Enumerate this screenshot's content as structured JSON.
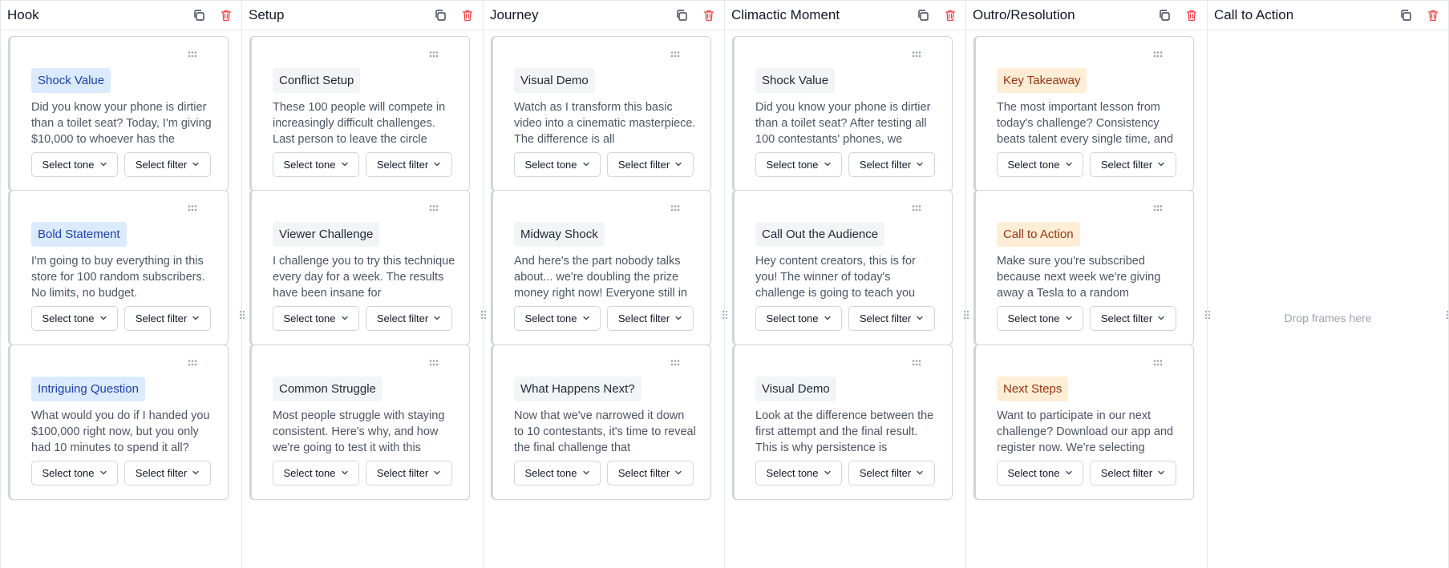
{
  "colors": {
    "border": "#e5e7eb",
    "delete": "#ef4444",
    "blue_tag_bg": "#dbeafe",
    "gray_tag_bg": "#f3f4f6",
    "orange_tag_bg": "#ffedd5"
  },
  "columns": [
    {
      "title": "Hook",
      "cards": [
        {
          "tag": "Shock Value",
          "tag_color": "blue",
          "text": "Did you know your phone is dirtier than a toilet seat? Today, I'm giving $10,000 to whoever has the",
          "tone": "Select tone",
          "filter": "Select filter"
        },
        {
          "tag": "Bold Statement",
          "tag_color": "blue",
          "text": "I'm going to buy everything in this store for 100 random subscribers. No limits, no budget.",
          "tone": "Select tone",
          "filter": "Select filter"
        },
        {
          "tag": "Intriguing Question",
          "tag_color": "blue",
          "text": "What would you do if I handed you $100,000 right now, but you only had 10 minutes to spend it all?",
          "tone": "Select tone",
          "filter": "Select filter"
        }
      ]
    },
    {
      "title": "Setup",
      "cards": [
        {
          "tag": "Conflict Setup",
          "tag_color": "gray",
          "text": "These 100 people will compete in increasingly difficult challenges. Last person to leave the circle",
          "tone": "Select tone",
          "filter": "Select filter"
        },
        {
          "tag": "Viewer Challenge",
          "tag_color": "gray",
          "text": "I challenge you to try this technique every day for a week. The results have been insane for",
          "tone": "Select tone",
          "filter": "Select filter"
        },
        {
          "tag": "Common Struggle",
          "tag_color": "gray",
          "text": "Most people struggle with staying consistent. Here's why, and how we're going to test it with this",
          "tone": "Select tone",
          "filter": "Select filter"
        }
      ]
    },
    {
      "title": "Journey",
      "cards": [
        {
          "tag": "Visual Demo",
          "tag_color": "gray",
          "text": "Watch as I transform this basic video into a cinematic masterpiece. The difference is all",
          "tone": "Select tone",
          "filter": "Select filter"
        },
        {
          "tag": "Midway Shock",
          "tag_color": "gray",
          "text": "And here's the part nobody talks about... we're doubling the prize money right now! Everyone still in",
          "tone": "Select tone",
          "filter": "Select filter"
        },
        {
          "tag": "What Happens Next?",
          "tag_color": "gray",
          "text": "Now that we've narrowed it down to 10 contestants, it's time to reveal the final challenge that",
          "tone": "Select tone",
          "filter": "Select filter"
        }
      ]
    },
    {
      "title": "Climactic Moment",
      "cards": [
        {
          "tag": "Shock Value",
          "tag_color": "gray",
          "text": "Did you know your phone is dirtier than a toilet seat? After testing all 100 contestants' phones, we",
          "tone": "Select tone",
          "filter": "Select filter"
        },
        {
          "tag": "Call Out the Audience",
          "tag_color": "gray",
          "text": "Hey content creators, this is for you! The winner of today's challenge is going to teach you",
          "tone": "Select tone",
          "filter": "Select filter"
        },
        {
          "tag": "Visual Demo",
          "tag_color": "gray",
          "text": "Look at the difference between the first attempt and the final result. This is why persistence is",
          "tone": "Select tone",
          "filter": "Select filter"
        }
      ]
    },
    {
      "title": "Outro/Resolution",
      "cards": [
        {
          "tag": "Key Takeaway",
          "tag_color": "orange",
          "text": "The most important lesson from today's challenge? Consistency beats talent every single time, and",
          "tone": "Select tone",
          "filter": "Select filter"
        },
        {
          "tag": "Call to Action",
          "tag_color": "orange",
          "text": "Make sure you're subscribed because next week we're giving away a Tesla to a random",
          "tone": "Select tone",
          "filter": "Select filter"
        },
        {
          "tag": "Next Steps",
          "tag_color": "orange",
          "text": "Want to participate in our next challenge? Download our app and register now. We're selecting",
          "tone": "Select tone",
          "filter": "Select filter"
        }
      ]
    },
    {
      "title": "Call to Action",
      "cards": [],
      "empty_text": "Drop frames here"
    }
  ],
  "icons": {
    "copy": "copy-icon",
    "delete": "trash-icon",
    "drag": "grip-icon",
    "chevron": "chevron-down-icon",
    "resize": "resize-handle-icon"
  }
}
